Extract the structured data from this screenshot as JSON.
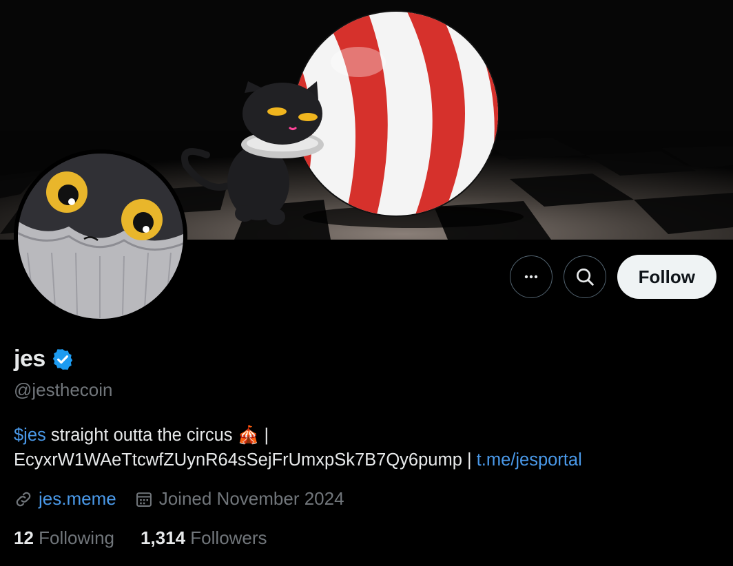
{
  "profile": {
    "display_name": "jes",
    "verified_icon": "verified-badge-icon",
    "handle": "@jesthecoin",
    "bio": {
      "cashtag": "$jes",
      "text1": " straight outta the circus ",
      "emoji": "🎪",
      "text2": " |",
      "contract": "EcyxrW1WAeTtcwfZUynR64sSejFrUmxpSk7B7Qy6pump",
      "sep": " | ",
      "link": "t.me/jesportal"
    },
    "website": "jes.meme",
    "joined": "Joined November 2024",
    "following_count": "12",
    "following_label": "Following",
    "followers_count": "1,314",
    "followers_label": "Followers"
  },
  "actions": {
    "more_icon": "more-dots-icon",
    "search_icon": "search-icon",
    "follow_label": "Follow"
  },
  "colors": {
    "background": "#000000",
    "link": "#4a99e9",
    "verified": "#1d9bf0",
    "muted_text": "#71767b",
    "follow_button_bg": "#eff3f4"
  }
}
